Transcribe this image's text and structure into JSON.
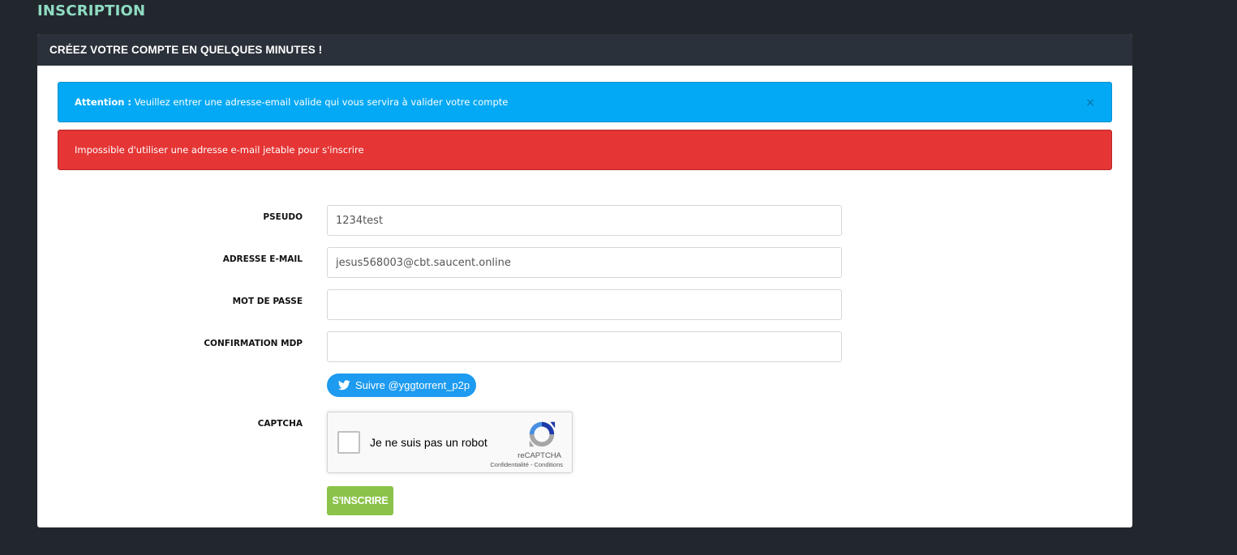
{
  "page": {
    "title": "INSCRIPTION"
  },
  "panel": {
    "header": "CRÉEZ VOTRE COMPTE EN QUELQUES MINUTES !"
  },
  "alerts": {
    "info": {
      "strong": "Attention :",
      "text": " Veuillez entrer une adresse-email valide qui vous servira à valider votre compte",
      "close": "×",
      "color": "#03a9f4"
    },
    "danger": {
      "text": "Impossible d'utiliser une adresse e-mail jetable pour s'inscrire",
      "color": "#e53535"
    }
  },
  "form": {
    "username": {
      "label": "PSEUDO",
      "value": "1234test"
    },
    "email": {
      "label": "ADRESSE E-MAIL",
      "value": "jesus568003@cbt.saucent.online"
    },
    "password": {
      "label": "MOT DE PASSE",
      "value": ""
    },
    "password_confirm": {
      "label": "CONFIRMATION MDP",
      "value": ""
    },
    "twitter_follow": "Suivre @yggtorrent_p2p",
    "captcha": {
      "label": "CAPTCHA",
      "checkbox_text": "Je ne suis pas un robot",
      "brand": "reCAPTCHA",
      "links": "Confidentialité - Conditions"
    },
    "submit_label": "S'INSCRIRE"
  },
  "colors": {
    "background": "#22272e",
    "title_accent": "#8fdcc2",
    "header_bg": "#2b313a",
    "submit": "#8bc34a",
    "twitter": "#1d9bf0"
  },
  "icons": {
    "close": "close-icon",
    "twitter": "twitter-bird-icon",
    "recaptcha": "recaptcha-logo-icon"
  }
}
